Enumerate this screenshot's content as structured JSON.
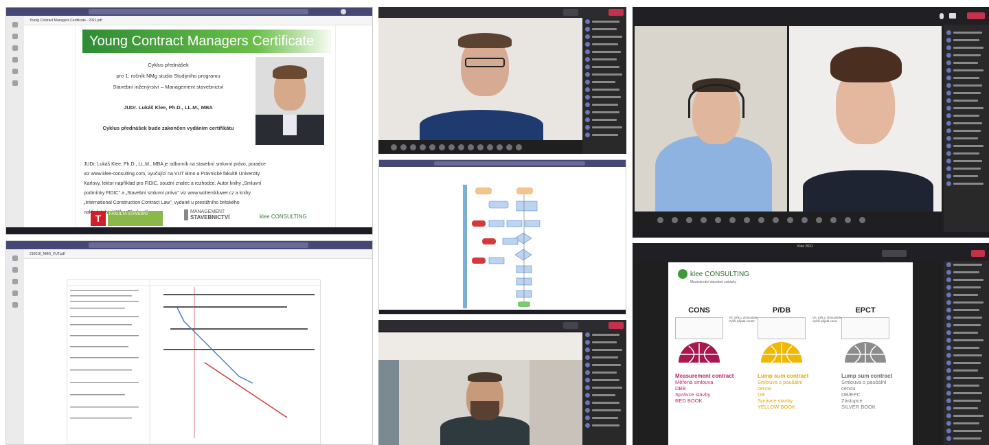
{
  "top_left": {
    "tab_title": "Young Contract Managers Certificate - 2021.pdf",
    "banner_title": "Young Contract Managers Certificate",
    "lines": [
      "Cyklus přednášek",
      "pro 1. ročník NMg studia Studijního programu",
      "Stavební inženýrství – Management stavebnictví"
    ],
    "presenter": "JUDr. Lukáš Klee, Ph.D., LL.M., MBA",
    "cert_note": "Cyklus přednášek bude zakončen vydáním certifikátu",
    "bio_lines": [
      "JUDr. Lukáš Klee, Ph.D., LL.M., MBA je odborník na stavební smluvní právo, poradce",
      "viz www.klee-consulting.com, vyučující na VUT Brno a Právnické fakultě Univerzity",
      "Karlovy, lektor například pro FIDIC, soudní znalec a rozhodce. Autor knihy „Smluvní",
      "podmínky FIDIC\" a „Stavební smluvní právo\" viz www.wolterskluwer.cz a knihy",
      "„International Construction Contract Law\", vydané u prestižního britského",
      "nakladatelství Wiley Blackwell."
    ],
    "logos": {
      "fakulta": "FAKULTA STAVEBNÍ",
      "management": "MANAGEMENT",
      "stavebnictvi": "STAVEBNICTVÍ",
      "klee": "klee CONSULTING"
    }
  },
  "bottom_left": {
    "tab_title": "210616_NMG_VUT.pdf"
  },
  "right_bottom": {
    "window_title": "Klee 2021",
    "logo": "klee CONSULTING",
    "logo_sub": "Mezinárodní stavební zakázky",
    "columns": [
      {
        "heading": "CONS",
        "color": "#a8174e",
        "title": "Measurement contract",
        "lines": [
          "Měřená smlouva",
          "DBB",
          "Správce stavby",
          "RED BOOK"
        ]
      },
      {
        "heading": "P/DB",
        "color": "#f2b705",
        "title": "Lump sum contract",
        "lines": [
          "Smlouva s paušální",
          "cenou",
          "DB",
          "Správce stavby",
          "YELLOW BOOK"
        ]
      },
      {
        "heading": "EPCT",
        "color": "#8c8c8c",
        "title": "Lump sum contract",
        "lines": [
          "Smlouva s paušální",
          "cenou",
          "DB/EPC",
          "Zástupce",
          "SILVER BOOK"
        ]
      }
    ],
    "arrow_notes": [
      "Víc rizik u zhotovitele\nVyšší přijatá cena?",
      "Víc rizik u zhotovitele\nVyšší přijatá cena"
    ]
  },
  "colors": {
    "teams_dark": "#2b2b30",
    "teams_purple": "#464775",
    "leave_red": "#c4314b",
    "banner_green": "#3c9a3a"
  },
  "icons": [
    "search-icon",
    "mic-icon",
    "camera-icon",
    "share-icon",
    "leave-icon",
    "avatar-icon"
  ]
}
